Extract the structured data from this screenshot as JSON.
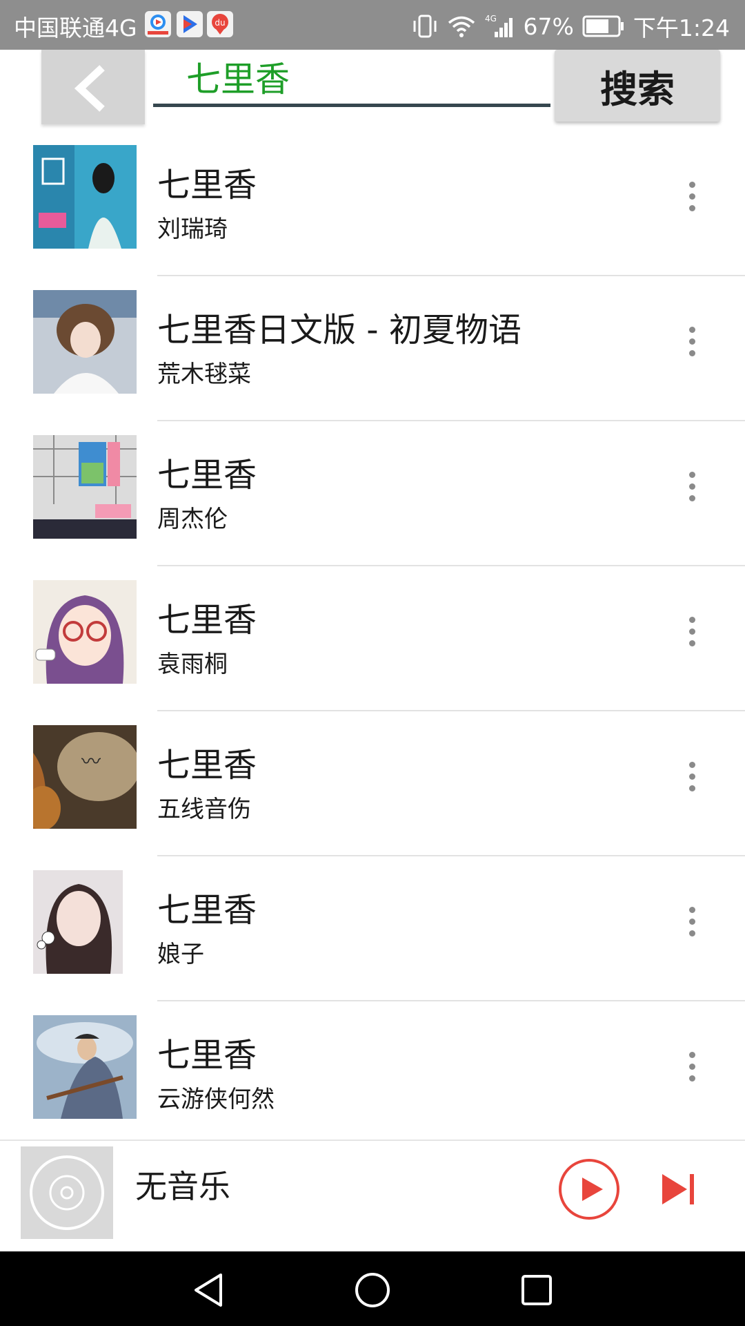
{
  "status_bar": {
    "carrier": "中国联通4G",
    "notification_icons": [
      "video-app-icon",
      "play-app-icon",
      "du-app-icon"
    ],
    "battery": "67%",
    "time": "下午1:24",
    "network_label": "4G"
  },
  "search": {
    "back_icon": "chevron-left-icon",
    "query": "七里香",
    "button_label": "搜索"
  },
  "results": [
    {
      "title": "七里香",
      "artist": "刘瑞琦"
    },
    {
      "title": "七里香日文版 - 初夏物语",
      "artist": "荒木毬菜"
    },
    {
      "title": "七里香",
      "artist": "周杰伦"
    },
    {
      "title": "七里香",
      "artist": "袁雨桐"
    },
    {
      "title": "七里香",
      "artist": "五线音伤"
    },
    {
      "title": "七里香",
      "artist": "娘子"
    },
    {
      "title": "七里香",
      "artist": "云游侠何然"
    }
  ],
  "player": {
    "title": "无音乐",
    "cover_icon": "disc-icon",
    "play_icon": "play-icon",
    "next_icon": "skip-next-icon"
  },
  "nav_bar": {
    "icons": [
      "back-triangle-icon",
      "home-circle-icon",
      "recents-square-icon"
    ]
  },
  "colors": {
    "query_text": "#1e9e28",
    "accent_red": "#e8453c",
    "status_bar": "#8e8e8e",
    "nav_bar": "#000000"
  }
}
